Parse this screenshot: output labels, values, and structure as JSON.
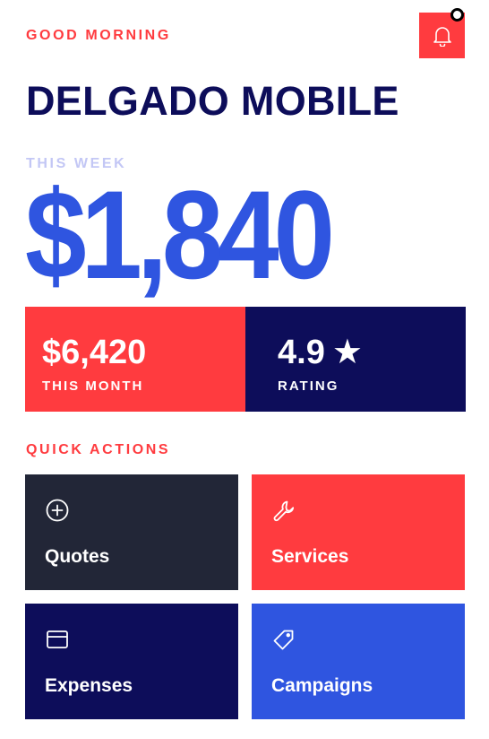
{
  "header": {
    "greeting": "GOOD MORNING",
    "business_name": "DELGADO MOBILE",
    "bell_icon": "bell-icon",
    "has_notification": true
  },
  "earnings": {
    "week_label": "THIS WEEK",
    "week_amount": "$1,840",
    "month_amount": "$6,420",
    "month_label": "THIS MONTH",
    "rating_value": "4.9",
    "rating_star": "★",
    "rating_label": "RATING"
  },
  "quick_actions": {
    "label": "QUICK ACTIONS",
    "items": [
      {
        "label": "Quotes",
        "icon": "plus-circle-icon",
        "color": "#222637"
      },
      {
        "label": "Services",
        "icon": "wrench-icon",
        "color": "#ff3b3f"
      },
      {
        "label": "Expenses",
        "icon": "card-icon",
        "color": "#0d0d5a"
      },
      {
        "label": "Campaigns",
        "icon": "tag-icon",
        "color": "#2f55e0"
      }
    ]
  },
  "colors": {
    "accent_red": "#ff3b3f",
    "navy": "#0d0d5a",
    "blue": "#2f55e0",
    "charcoal": "#222637",
    "muted_lavender": "#c3c7f5"
  }
}
